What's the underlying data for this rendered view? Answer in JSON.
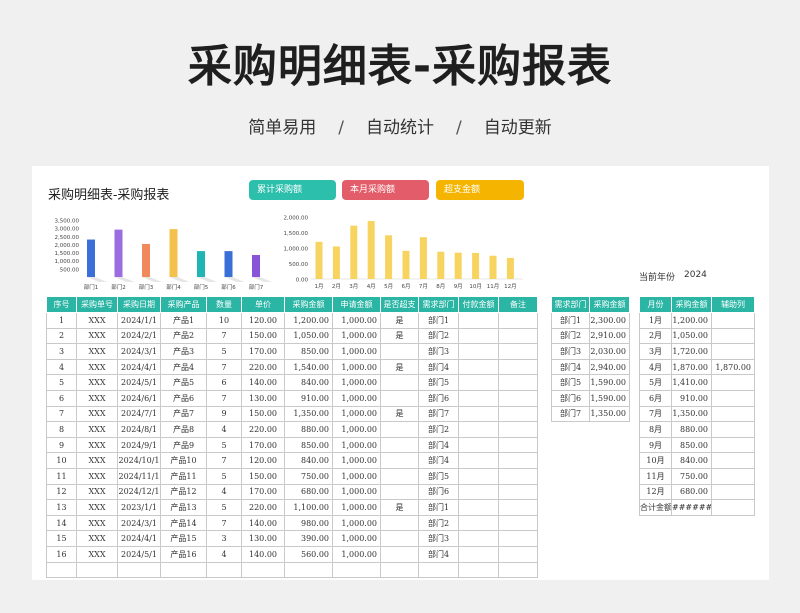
{
  "header": {
    "title": "采购明细表-采购报表",
    "sub1": "简单易用",
    "sep1": "/",
    "sub2": "自动统计",
    "sep2": "/",
    "sub3": "自动更新"
  },
  "sheet": {
    "title": "采购明细表-采购报表",
    "kpis": [
      {
        "label": "累计采购额",
        "color": "#2bbfac"
      },
      {
        "label": "本月采购额",
        "color": "#e35c6a"
      },
      {
        "label": "超支金额",
        "color": "#f4b400"
      }
    ],
    "year_label": "当前年份",
    "year_value": "2024"
  },
  "chart_data": [
    {
      "type": "bar",
      "categories": [
        "部门1",
        "部门2",
        "部门3",
        "部门4",
        "部门5",
        "部门6",
        "部门7"
      ],
      "values": [
        2300,
        2910,
        2030,
        2940,
        1590,
        1590,
        1350
      ],
      "colors": [
        "#3b6fd8",
        "#9b6ee0",
        "#f08a5c",
        "#f4c04e",
        "#1fb5b5",
        "#3b6fd8",
        "#8a54d8"
      ],
      "yticks": [
        "3,500.00",
        "3,000.00",
        "2,500.00",
        "2,000.00",
        "1,500.00",
        "1,000.00",
        "500.00"
      ],
      "ylim": [
        0,
        3500
      ]
    },
    {
      "type": "bar",
      "categories": [
        "1月",
        "2月",
        "3月",
        "4月",
        "5月",
        "6月",
        "7月",
        "8月",
        "9月",
        "10月",
        "11月",
        "12月"
      ],
      "values": [
        1200,
        1050,
        1720,
        1870,
        1410,
        910,
        1350,
        880,
        850,
        840,
        750,
        680
      ],
      "color": "#f7d35f",
      "yticks": [
        "2,000.00",
        "1,500.00",
        "1,000.00",
        "500.00",
        "0.00"
      ],
      "ylim": [
        0,
        2000
      ]
    }
  ],
  "main_table": {
    "headers": [
      "序号",
      "采购单号",
      "采购日期",
      "采购产品",
      "数量",
      "单价",
      "采购金额",
      "申请金额",
      "是否超支",
      "需求部门",
      "付款金额",
      "备注"
    ],
    "rows": [
      [
        "1",
        "XXX",
        "2024/1/1",
        "产品1",
        "10",
        "120.00",
        "1,200.00",
        "1,000.00",
        "是",
        "部门1",
        "",
        ""
      ],
      [
        "2",
        "XXX",
        "2024/2/1",
        "产品2",
        "7",
        "150.00",
        "1,050.00",
        "1,000.00",
        "是",
        "部门2",
        "",
        ""
      ],
      [
        "3",
        "XXX",
        "2024/3/1",
        "产品3",
        "5",
        "170.00",
        "850.00",
        "1,000.00",
        "",
        "部门3",
        "",
        ""
      ],
      [
        "4",
        "XXX",
        "2024/4/1",
        "产品4",
        "7",
        "220.00",
        "1,540.00",
        "1,000.00",
        "是",
        "部门4",
        "",
        ""
      ],
      [
        "5",
        "XXX",
        "2024/5/1",
        "产品5",
        "6",
        "140.00",
        "840.00",
        "1,000.00",
        "",
        "部门5",
        "",
        ""
      ],
      [
        "6",
        "XXX",
        "2024/6/1",
        "产品6",
        "7",
        "130.00",
        "910.00",
        "1,000.00",
        "",
        "部门6",
        "",
        ""
      ],
      [
        "7",
        "XXX",
        "2024/7/1",
        "产品7",
        "9",
        "150.00",
        "1,350.00",
        "1,000.00",
        "是",
        "部门7",
        "",
        ""
      ],
      [
        "8",
        "XXX",
        "2024/8/1",
        "产品8",
        "4",
        "220.00",
        "880.00",
        "1,000.00",
        "",
        "部门2",
        "",
        ""
      ],
      [
        "9",
        "XXX",
        "2024/9/1",
        "产品9",
        "5",
        "170.00",
        "850.00",
        "1,000.00",
        "",
        "部门4",
        "",
        ""
      ],
      [
        "10",
        "XXX",
        "2024/10/1",
        "产品10",
        "7",
        "120.00",
        "840.00",
        "1,000.00",
        "",
        "部门4",
        "",
        ""
      ],
      [
        "11",
        "XXX",
        "2024/11/1",
        "产品11",
        "5",
        "150.00",
        "750.00",
        "1,000.00",
        "",
        "部门5",
        "",
        ""
      ],
      [
        "12",
        "XXX",
        "2024/12/1",
        "产品12",
        "4",
        "170.00",
        "680.00",
        "1,000.00",
        "",
        "部门6",
        "",
        ""
      ],
      [
        "13",
        "XXX",
        "2023/1/1",
        "产品13",
        "5",
        "220.00",
        "1,100.00",
        "1,000.00",
        "是",
        "部门1",
        "",
        ""
      ],
      [
        "14",
        "XXX",
        "2024/3/1",
        "产品14",
        "7",
        "140.00",
        "980.00",
        "1,000.00",
        "",
        "部门2",
        "",
        ""
      ],
      [
        "15",
        "XXX",
        "2024/4/1",
        "产品15",
        "3",
        "130.00",
        "390.00",
        "1,000.00",
        "",
        "部门3",
        "",
        ""
      ],
      [
        "16",
        "XXX",
        "2024/5/1",
        "产品16",
        "4",
        "140.00",
        "560.00",
        "1,000.00",
        "",
        "部门4",
        "",
        ""
      ],
      [
        "",
        "",
        "",
        "",
        "",
        "",
        "",
        "",
        "",
        "",
        "",
        ""
      ]
    ]
  },
  "dept_table": {
    "headers": [
      "需求部门",
      "采购金额"
    ],
    "rows": [
      [
        "部门1",
        "2,300.00"
      ],
      [
        "部门2",
        "2,910.00"
      ],
      [
        "部门3",
        "2,030.00"
      ],
      [
        "部门4",
        "2,940.00"
      ],
      [
        "部门5",
        "1,590.00"
      ],
      [
        "部门6",
        "1,590.00"
      ],
      [
        "部门7",
        "1,350.00"
      ]
    ]
  },
  "month_table": {
    "headers": [
      "月份",
      "采购金额",
      "辅助列"
    ],
    "rows": [
      [
        "1月",
        "1,200.00",
        ""
      ],
      [
        "2月",
        "1,050.00",
        ""
      ],
      [
        "3月",
        "1,720.00",
        ""
      ],
      [
        "4月",
        "1,870.00",
        "1,870.00"
      ],
      [
        "5月",
        "1,410.00",
        ""
      ],
      [
        "6月",
        "910.00",
        ""
      ],
      [
        "7月",
        "1,350.00",
        ""
      ],
      [
        "8月",
        "880.00",
        ""
      ],
      [
        "9月",
        "850.00",
        ""
      ],
      [
        "10月",
        "840.00",
        ""
      ],
      [
        "11月",
        "750.00",
        ""
      ],
      [
        "12月",
        "680.00",
        ""
      ],
      [
        "合计金额",
        "##########",
        ""
      ]
    ]
  }
}
